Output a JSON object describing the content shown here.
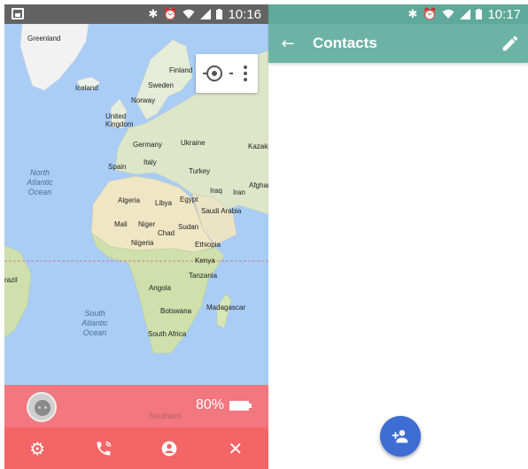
{
  "left_screen": {
    "status_bar": {
      "time": "10:16"
    },
    "map": {
      "labels": {
        "greenland": "Greenland",
        "iceland": "Iceland",
        "finland": "Finland",
        "sweden": "Sweden",
        "norway": "Norway",
        "united_kingdom": "United Kingdom",
        "germany": "Germany",
        "ukraine": "Ukraine",
        "kazakh": "Kazakh",
        "spain": "Spain",
        "italy": "Italy",
        "turkey": "Turkey",
        "iraq": "Iraq",
        "iran": "Iran",
        "afghan": "Afghar",
        "algeria": "Algeria",
        "libya": "Libya",
        "egypt": "Egypt",
        "saudi_arabia": "Saudi Arabia",
        "mali": "Mali",
        "niger": "Niger",
        "chad": "Chad",
        "sudan": "Sudan",
        "nigeria": "Nigeria",
        "ethiopia": "Ethiopia",
        "kenya": "Kenya",
        "tanzania": "Tanzania",
        "angola": "Angola",
        "botswana": "Botswana",
        "madagascar": "Madagascar",
        "south_africa": "South Africa",
        "brazil": "razil",
        "north_atlantic": "North Atlantic Ocean",
        "south_atlantic": "South Atlantic Ocean"
      },
      "overlay_faint_label": "Southern"
    },
    "battery": {
      "percent_text": "80%"
    }
  },
  "right_screen": {
    "status_bar": {
      "time": "10:17"
    },
    "app_bar": {
      "title": "Contacts"
    }
  },
  "colors": {
    "left_status": "#636363",
    "map_water": "#a9cdf5",
    "panel_pink": "#f67278",
    "action_red": "#f46565",
    "teal_status": "#5fa99a",
    "teal_appbar": "#6db3a5",
    "fab_blue": "#3e6ed4"
  },
  "icons": {
    "left_toolbar": [
      "settings-gear-icon",
      "phone-call-icon",
      "account-circle-icon",
      "close-icon"
    ],
    "right_appbar": [
      "back-arrow-icon",
      "edit-pencil-icon"
    ],
    "fab": "add-person-icon"
  }
}
